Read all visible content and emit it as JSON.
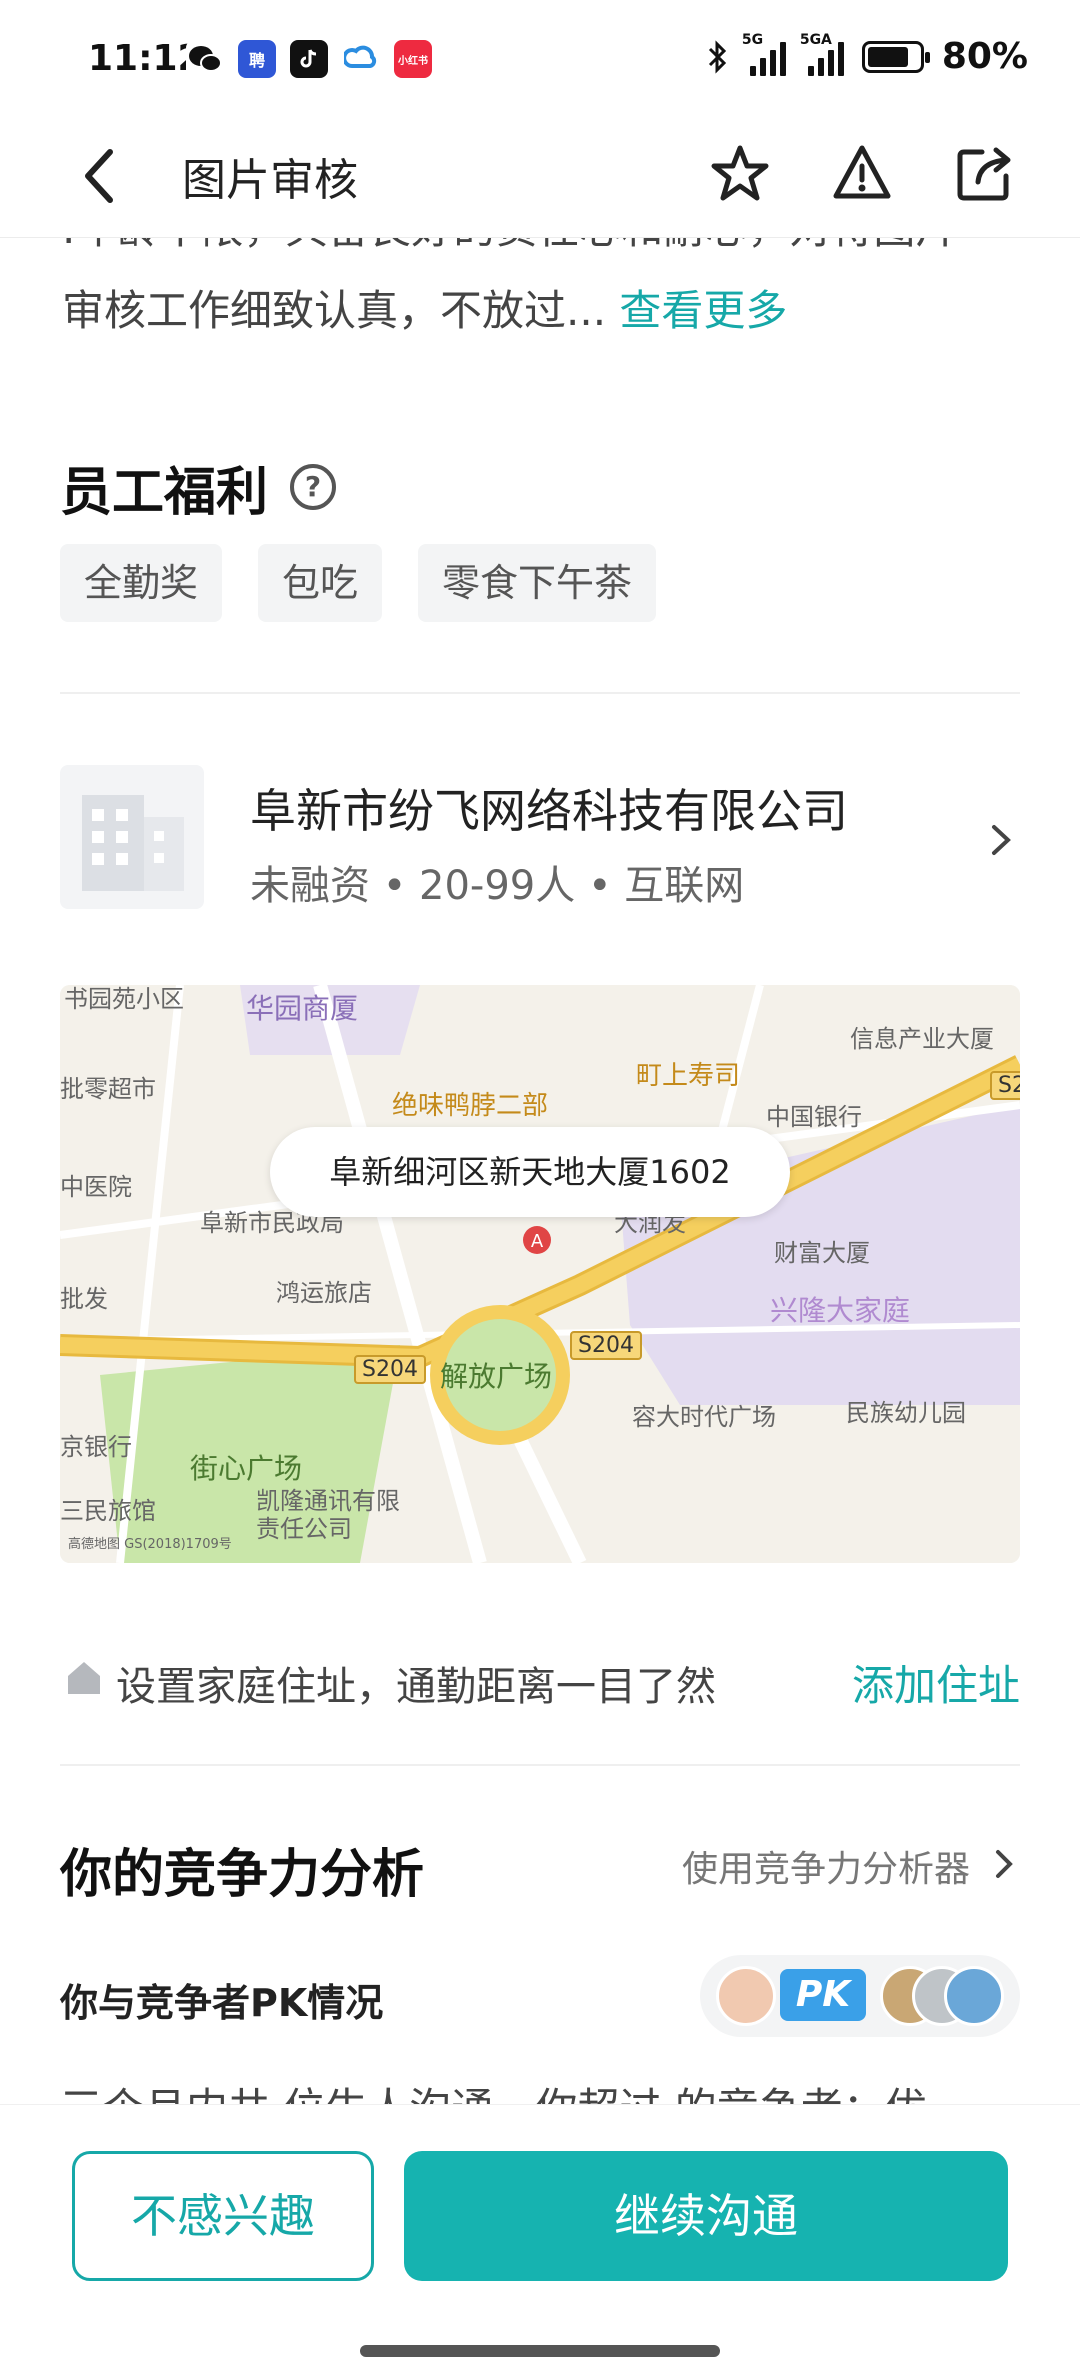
{
  "status_bar": {
    "time": "11:12",
    "battery": "80%",
    "battery_level": 0.8,
    "network_1": "5G",
    "network_2": "5GA",
    "apps": [
      "wechat-icon",
      "zhaopin-icon",
      "tiktok-icon",
      "cloud-icon",
      "xiaohongshu-icon"
    ],
    "xiaohongshu_label": "小红书",
    "zhaopin_label": "聘"
  },
  "nav": {
    "title": "图片审核",
    "icons": [
      "back-chevron-icon",
      "star-icon",
      "warning-icon",
      "share-icon"
    ]
  },
  "job": {
    "description_cut": ".年龄不限，具备良好的责任心和耐心，对待图片",
    "description": "审核工作细致认真，不放过...",
    "more_label": "查看更多"
  },
  "benefits": {
    "title": "员工福利",
    "help_symbol": "?",
    "tags": [
      "全勤奖",
      "包吃",
      "零食下午茶"
    ]
  },
  "company": {
    "name": "阜新市纷飞网络科技有限公司",
    "meta": "未融资 • 20-99人 • 互联网"
  },
  "map": {
    "address": "阜新细河区新天地大厦1602",
    "labels": {
      "l1": "书园苑小区",
      "l2": "华园商厦",
      "l3": "信息产业大厦",
      "l4": "町上寿司",
      "l5": "批零超市",
      "l6": "绝味鸭脖二部",
      "l7": "中国银行",
      "l8": "中医院",
      "l9": "阜新市民政局",
      "l10": "大润发",
      "l11": "财富大厦",
      "l12": "鸿运旅店",
      "l13": "批发",
      "l14": "兴隆大家庭",
      "l15": "解放广场",
      "l16": "容大时代广场",
      "l17": "民族幼儿园",
      "l18": "京银行",
      "l19": "街心广场",
      "l20": "三民旅馆",
      "l21": "凯隆通讯有限责任公司",
      "road1": "S204",
      "road2": "S204",
      "road3": "S2",
      "copyright": "高德地图 GS(2018)1709号"
    },
    "colors": {
      "road": "#f5cf5e",
      "park": "#c9e6a9",
      "district": "#e3dcf0"
    }
  },
  "home": {
    "text": "设置家庭住址，通勤距离一目了然",
    "link": "添加住址"
  },
  "competition": {
    "title": "你的竞争力分析",
    "link": "使用竞争力分析器",
    "pk_title": "你与竞争者PK情况",
    "pk_badge": "PK",
    "cut_text": "三个月内共   位牛人沟通，你超过   的竞争者；优"
  },
  "actions": {
    "not_interested": "不感兴趣",
    "continue_chat": "继续沟通"
  },
  "colors": {
    "accent": "#16a8a8",
    "primary_button": "#16b3b0"
  }
}
